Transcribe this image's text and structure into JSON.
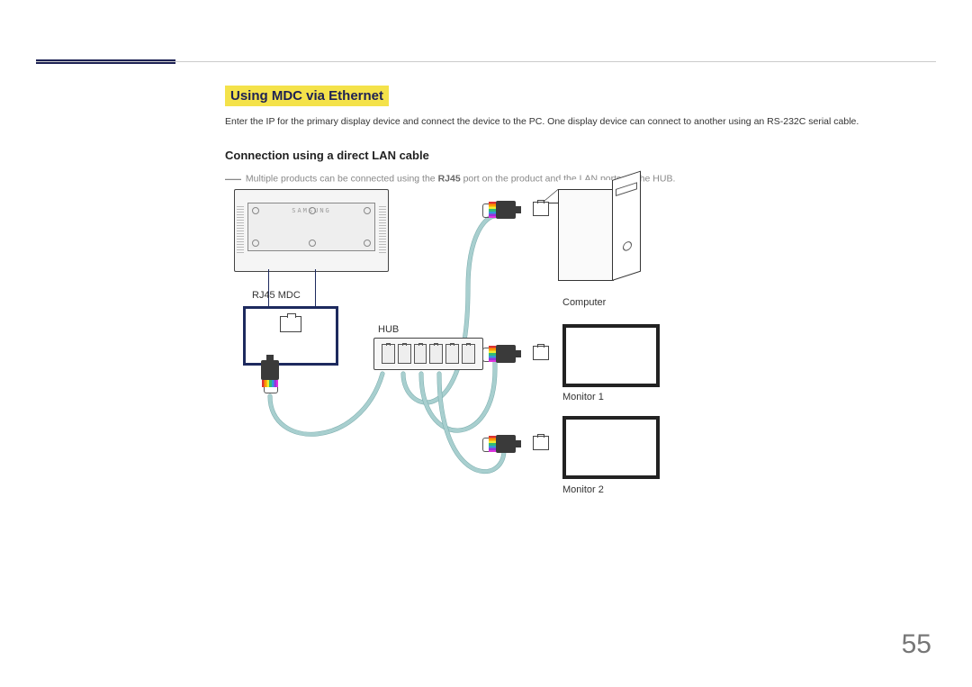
{
  "page": {
    "number": "55"
  },
  "section": {
    "title": "Using MDC via Ethernet",
    "intro": "Enter the IP for the primary display device and connect the device to the PC. One display device can connect to another using an RS-232C serial cable.",
    "sub_heading": "Connection using a direct LAN cable",
    "note_prefix": "―",
    "note_before": "Multiple products can be connected using the ",
    "note_bold": "RJ45",
    "note_after": " port on the product and the LAN ports on the HUB."
  },
  "diagram": {
    "rj45_label": "RJ45 MDC",
    "hub_label": "HUB",
    "computer_label": "Computer",
    "monitor1_label": "Monitor 1",
    "monitor2_label": "Monitor 2",
    "brand_text": "SAMSUNG"
  }
}
